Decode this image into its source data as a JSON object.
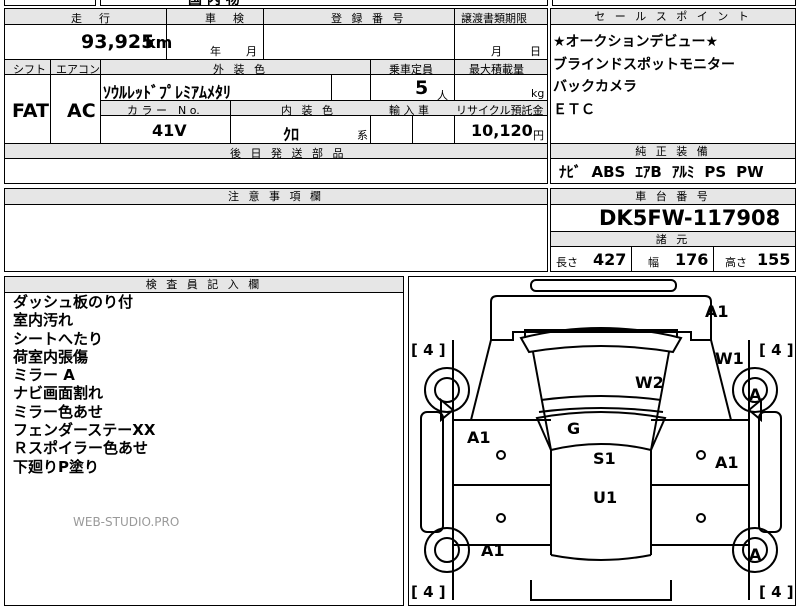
{
  "header_top": {
    "partial_text": "国 内 物"
  },
  "vehicle": {
    "labels": {
      "mileage": "走　行",
      "inspection": "車　検",
      "registration": "登 録 番 号",
      "transfer_deadline": "譲渡書類期限",
      "shift": "シフト",
      "aircon": "エアコン",
      "exterior_color": "外 装 色",
      "capacity": "乗車定員",
      "max_load": "最大積載量",
      "color_no": "カ ラ ー　N o.",
      "interior_color": "内 装 色",
      "import": "輸 入 車",
      "recycle_fee": "リサイクル預託金",
      "parts": "後 日 発 送 部 品",
      "year_unit": "年",
      "month_unit": "月",
      "month_unit2": "月",
      "day_unit": "日",
      "km_unit": "km",
      "person_unit": "人",
      "kg_unit": "kg",
      "yen_unit": "円",
      "system_unit": "系"
    },
    "mileage": "93,925",
    "shift": "FAT",
    "aircon": "AC",
    "exterior_color": "ｿｳﾙﾚｯﾄﾞﾌﾟﾚﾐｱﾑﾒﾀﾘ",
    "capacity": "5",
    "color_no": "41V",
    "interior_color": "ｸﾛ",
    "recycle_fee": "10,120"
  },
  "sales_points": {
    "header": "セ ー ル ス ポ イ ン ト",
    "items": [
      "★オークションデビュー★",
      "ブラインドスポットモニター",
      "バックカメラ",
      "ＥＴＣ"
    ]
  },
  "equipment": {
    "header": "純 正 装 備",
    "items": [
      "ﾅﾋﾞ",
      "ABS",
      "ｴｱB",
      "ｱﾙﾐ",
      "PS",
      "PW"
    ]
  },
  "notes": {
    "header": "注 意 事 項 欄"
  },
  "chassis": {
    "header": "車 台 番 号",
    "number": "DK5FW-117908"
  },
  "specs": {
    "header": "諸 元",
    "length_label": "長さ",
    "length": "427",
    "width_label": "幅",
    "width": "176",
    "height_label": "高さ",
    "height": "155"
  },
  "inspector": {
    "header": "検 査 員 記 入 欄",
    "items": [
      "ダッシュ板のり付",
      "室内汚れ",
      "シートへたり",
      "荷室内張傷",
      "ミラー A",
      "ナビ画面割れ",
      "ミラー色あせ",
      "フェンダーステーXX",
      "Ｒスポイラー色あせ",
      "下廻りP塗り"
    ],
    "watermark": "WEB-STUDIO.PRO"
  },
  "diagram": {
    "damage_marks": [
      "A1",
      "W1",
      "W2",
      "A",
      "G",
      "A1",
      "A1",
      "S1",
      "U1",
      "A1",
      "A"
    ],
    "tire_marks": [
      "[ 4 ]",
      "[ 4 ]",
      "[ 4 ]",
      "[ 4 ]"
    ]
  },
  "colors": {
    "header_bg": "#e6e6e6",
    "line": "#000000",
    "watermark": "#9a9a9a"
  }
}
